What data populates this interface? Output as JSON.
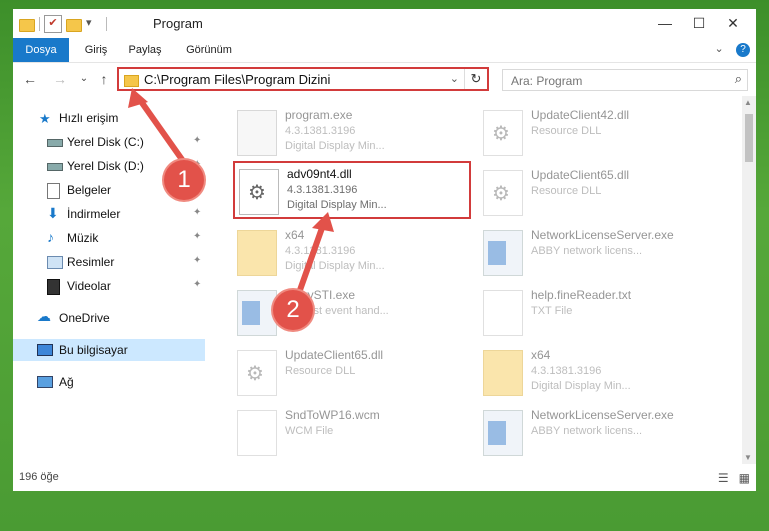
{
  "window": {
    "title": "Program",
    "controls": {
      "minimize": "—",
      "maximize": "☐",
      "close": "✕"
    }
  },
  "ribbon": {
    "tabs": [
      {
        "label": "Dosya",
        "active": true
      },
      {
        "label": "Giriş",
        "active": false
      },
      {
        "label": "Paylaş",
        "active": false
      },
      {
        "label": "Görünüm",
        "active": false
      }
    ],
    "expand_icon": "⌄",
    "help_icon": "?"
  },
  "nav": {
    "back_icon": "←",
    "forward_icon": "→",
    "recent_icon": "⌄",
    "up_icon": "↑",
    "address": "C:\\Program Files\\Program Dizini",
    "refresh_icon": "↻",
    "dropdown_icon": "⌄",
    "search_placeholder": "Ara: Program",
    "search_icon": "⌕"
  },
  "sidebar": {
    "items": [
      {
        "label": "Hızlı erişim",
        "icon": "star-icon",
        "pinned": false
      },
      {
        "label": "Yerel Disk (C:)",
        "icon": "drive-icon",
        "pinned": true
      },
      {
        "label": "Yerel Disk (D:)",
        "icon": "drive-icon",
        "pinned": true
      },
      {
        "label": "Belgeler",
        "icon": "documents-icon",
        "pinned": true
      },
      {
        "label": "İndirmeler",
        "icon": "download-icon",
        "pinned": true
      },
      {
        "label": "Müzik",
        "icon": "music-icon",
        "pinned": true
      },
      {
        "label": "Resimler",
        "icon": "pictures-icon",
        "pinned": true
      },
      {
        "label": "Videolar",
        "icon": "videos-icon",
        "pinned": true
      },
      {
        "label": "OneDrive",
        "icon": "cloud-icon",
        "pinned": false
      },
      {
        "label": "Bu bilgisayar",
        "icon": "computer-icon",
        "pinned": false,
        "selected": true
      },
      {
        "label": "Ağ",
        "icon": "network-icon",
        "pinned": false
      }
    ],
    "pin_glyph": "📌"
  },
  "files": [
    {
      "name": "program.exe",
      "line2": "4.3.1381.3196",
      "line3": "Digital Display Min...",
      "icon": "exe-icon",
      "highlight": false
    },
    {
      "name": "UpdateClient42.dll",
      "line2": "Resource DLL",
      "line3": "",
      "icon": "dll-icon",
      "highlight": false
    },
    {
      "name": "adv09nt4.dll",
      "line2": "4.3.1381.3196",
      "line3": "Digital Display Min...",
      "icon": "dll-icon",
      "highlight": true
    },
    {
      "name": "UpdateClient65.dll",
      "line2": "Resource DLL",
      "line3": "",
      "icon": "dll-icon",
      "highlight": false
    },
    {
      "name": "x64",
      "line2": "4.3.1381.3196",
      "line3": "Digital Display Min...",
      "icon": "folder-icon",
      "highlight": false
    },
    {
      "name": "NetworkLicenseServer.exe",
      "line2": "ABBY network licens...",
      "line3": "",
      "icon": "app-icon",
      "highlight": false
    },
    {
      "name": "...hyySTI.exe",
      "line2": "...ST ist event hand...",
      "line3": "",
      "icon": "app-icon",
      "highlight": false
    },
    {
      "name": "help.fineReader.txt",
      "line2": "TXT File",
      "line3": "",
      "icon": "txt-icon",
      "highlight": false
    },
    {
      "name": "UpdateClient65.dll",
      "line2": "Resource DLL",
      "line3": "",
      "icon": "dll-icon",
      "highlight": false
    },
    {
      "name": "x64",
      "line2": "4.3.1381.3196",
      "line3": "Digital Display Min...",
      "icon": "folder-icon",
      "highlight": false
    },
    {
      "name": "SndToWP16.wcm",
      "line2": "WCM File",
      "line3": "",
      "icon": "txt-icon",
      "highlight": false
    },
    {
      "name": "NetworkLicenseServer.exe",
      "line2": "ABBY network licens...",
      "line3": "",
      "icon": "app-icon",
      "highlight": false
    }
  ],
  "status": {
    "count": "196 öğe",
    "details_view_icon": "☰",
    "tiles_view_icon": "▦"
  },
  "callouts": [
    "1",
    "2"
  ],
  "colors": {
    "accent": "#1979ca",
    "highlight": "#d23b3b",
    "callout": "#e2524a",
    "background": "#4a9b33"
  }
}
